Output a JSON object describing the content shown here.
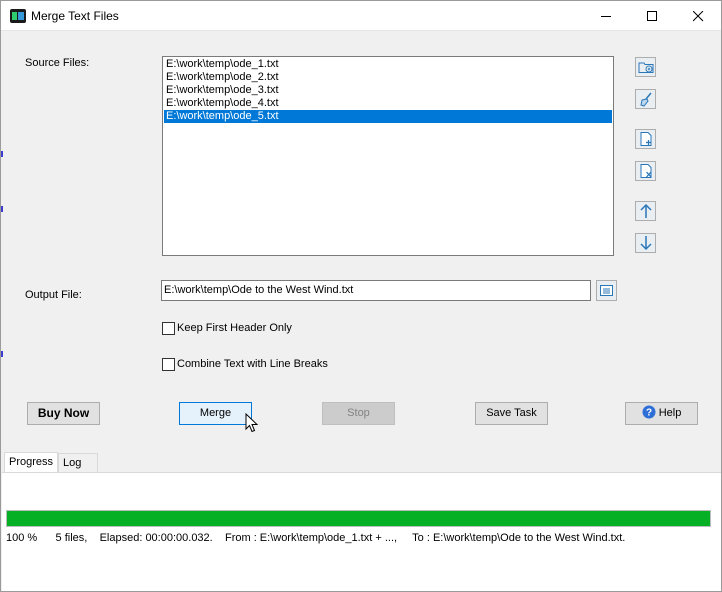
{
  "window": {
    "title": "Merge Text Files",
    "controls": [
      "minimize-icon",
      "maximize-icon",
      "close-icon"
    ]
  },
  "source": {
    "label": "Source Files:",
    "files": [
      "E:\\work\\temp\\ode_1.txt",
      "E:\\work\\temp\\ode_2.txt",
      "E:\\work\\temp\\ode_3.txt",
      "E:\\work\\temp\\ode_4.txt",
      "E:\\work\\temp\\ode_5.txt"
    ],
    "selected_index": 4,
    "side_buttons": [
      "add-folder-icon",
      "clear-list-icon",
      "add-file-icon",
      "remove-file-icon",
      "move-up-icon",
      "move-down-icon"
    ]
  },
  "output": {
    "label": "Output File:",
    "value": "E:\\work\\temp\\Ode to the West Wind.txt"
  },
  "options": {
    "keep_header": {
      "label": "Keep First Header Only",
      "checked": false
    },
    "line_breaks": {
      "label": "Combine Text with Line Breaks",
      "checked": false
    }
  },
  "buttons": {
    "buy_now": "Buy Now",
    "merge": "Merge",
    "stop": "Stop",
    "save_task": "Save Task",
    "help": "Help"
  },
  "tabs": [
    {
      "label": "Progress",
      "active": true
    },
    {
      "label": "Log",
      "active": false
    }
  ],
  "progress": {
    "value_percent": 100,
    "percent_text": "100 %",
    "files_text": "5 files,",
    "elapsed_text": "Elapsed: 00:00:00.032.",
    "from_text": "From : E:\\work\\temp\\ode_1.txt + ...,",
    "to_text": "To : E:\\work\\temp\\Ode to the West Wind.txt.",
    "fill_color": "#06b025"
  },
  "colors": {
    "selection": "#0078d7",
    "default_button_border": "#0078d7",
    "progress_fill": "#06b025"
  }
}
